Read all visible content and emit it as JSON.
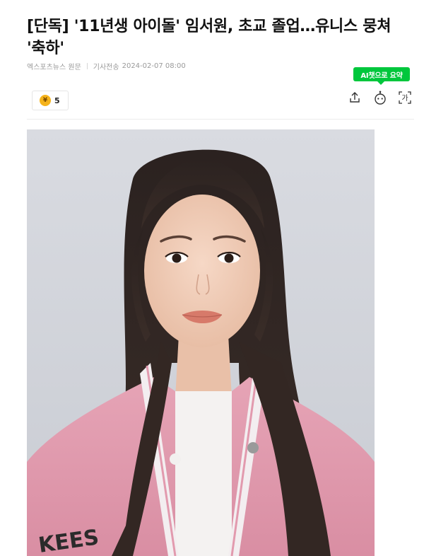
{
  "article": {
    "headline": "[단독] '11년생 아이돌' 임서원, 초교 졸업…유니스 뭉쳐 '축하'",
    "press": "엑스포츠뉴스 원문",
    "sent_label": "기사전송",
    "sent_time": "2024-02-07 08:00"
  },
  "toolbar": {
    "ai_summary_label": "AI챗으로 요약",
    "reaction_count": "5",
    "coin_glyph": "¥",
    "icons": [
      "share-icon",
      "ai-chat-icon",
      "font-size-icon"
    ],
    "font_icon_text": "가"
  },
  "colors": {
    "accent_green": "#00c73c",
    "coin_yellow": "#f5b31b"
  },
  "photo": {
    "jacket_text": "KEES"
  }
}
